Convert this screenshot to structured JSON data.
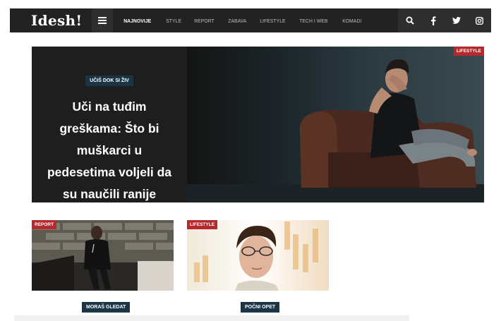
{
  "site": {
    "logo": "Idesh!"
  },
  "nav": {
    "items": [
      {
        "label": "NAJNOVIJE",
        "active": true
      },
      {
        "label": "STYLE",
        "active": false
      },
      {
        "label": "REPORT",
        "active": false
      },
      {
        "label": "ZABAVA",
        "active": false
      },
      {
        "label": "LIFESTYLE",
        "active": false
      },
      {
        "label": "TECH I WEB",
        "active": false
      },
      {
        "label": "KOMADI",
        "active": false
      }
    ],
    "icons": [
      "search-icon",
      "facebook-icon",
      "twitter-icon",
      "instagram-icon"
    ]
  },
  "hero": {
    "kicker": "UČIŠ DOK SI ŽIV",
    "title_lines": [
      "Uči na tuđim",
      "greškama: Što bi",
      "muškarci u",
      "pedesetima voljeli da",
      "su naučili ranije"
    ],
    "category": "LIFESTYLE"
  },
  "cards": [
    {
      "category": "REPORT",
      "label": "MORAŠ GLEDAT"
    },
    {
      "category": "LIFESTYLE",
      "label": "POČNI OPET"
    }
  ],
  "colors": {
    "navbar": "#222222",
    "badge_red": "#b5282c",
    "label_navy": "#1b3547"
  }
}
